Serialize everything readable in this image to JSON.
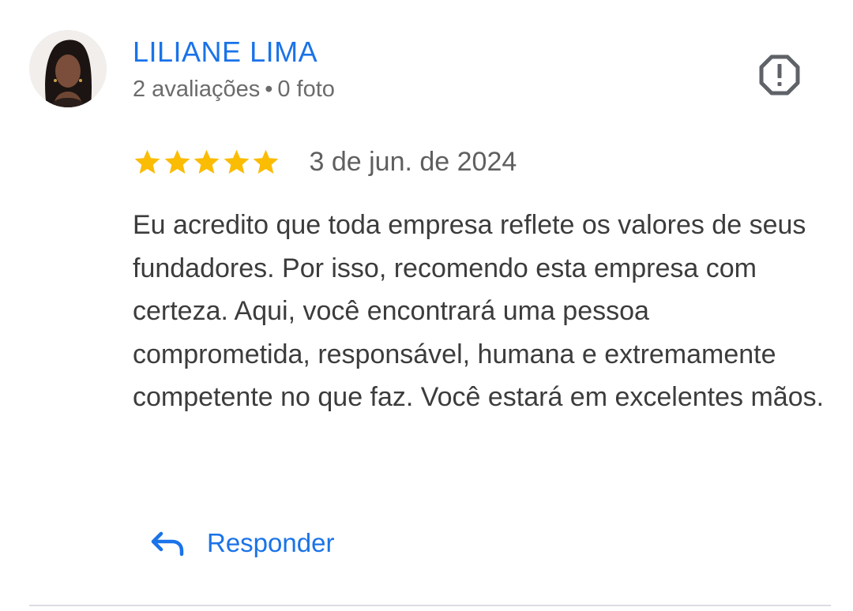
{
  "review": {
    "author": {
      "name": "LILIANE LIMA",
      "reviews_count": "2 avaliações",
      "separator": "•",
      "photos_count": "0 foto"
    },
    "rating": 5,
    "max_rating": 5,
    "date": "3 de jun. de 2024",
    "text": "Eu acredito que toda empresa reflete os valores de seus fundadores. Por isso, recomendo esta empresa com certeza. Aqui, você encontrará uma pessoa comprometida, responsável, humana e extremamente competente no que faz. Você estará em excelentes mãos.",
    "actions": {
      "reply_label": "Responder"
    }
  },
  "icons": {
    "star": "star-icon",
    "report": "report-flag-icon",
    "reply": "reply-arrow-icon"
  },
  "colors": {
    "accent": "#1a73e8",
    "star": "#fbbc04",
    "text": "#3c3c3c",
    "muted": "#6b6b6b",
    "report_icon": "#5f6368"
  }
}
